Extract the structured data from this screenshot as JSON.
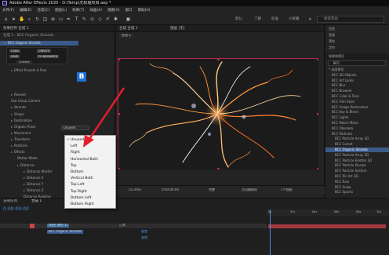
{
  "window": {
    "title": "Adobe After Effects 2020 - D:\\Temp\\无标题项目.aep *"
  },
  "menu": [
    "文件(F)",
    "编辑(E)",
    "合成(C)",
    "图层(L)",
    "效果(T)",
    "动画(A)",
    "视图(V)",
    "窗口",
    "帮助(H)"
  ],
  "toolbar": {
    "workspaces": [
      "默认",
      "了解",
      "标准",
      "小屏幕"
    ],
    "search_placeholder": "搜索帮助"
  },
  "effects_panel": {
    "tab_label": "效果控件 合成 1",
    "layer_label": "合成 1 · BCC Organic Strands",
    "effect_name": "BCC Organic Strands",
    "rows": [
      {
        "label": "BCC Organic Strands",
        "indent": 0,
        "caret": true
      },
      {
        "label": "Effect Presets & Pixe",
        "indent": 1,
        "caret": true
      },
      {
        "label": "Reseed",
        "indent": 1,
        "caret": true
      },
      {
        "label": "Use Comp Camera",
        "indent": 1,
        "caret": false
      },
      {
        "label": "Strands",
        "indent": 1,
        "caret": true
      },
      {
        "label": "Shape",
        "indent": 1,
        "caret": true
      },
      {
        "label": "Destination",
        "indent": 1,
        "caret": true
      },
      {
        "label": "Organic Pulse",
        "indent": 1,
        "caret": true
      },
      {
        "label": "Movement",
        "indent": 1,
        "caret": true
      },
      {
        "label": "Transform",
        "indent": 1,
        "caret": true
      },
      {
        "label": "Particles",
        "indent": 1,
        "caret": true
      },
      {
        "label": "Effects",
        "indent": 1,
        "caret": true
      },
      {
        "label": "Motion Mode",
        "indent": 2,
        "caret": false
      },
      {
        "label": "Distance",
        "indent": 2,
        "caret": true
      },
      {
        "label": "Distance Master",
        "indent": 3,
        "caret": true
      },
      {
        "label": "Distance X",
        "indent": 3,
        "caret": true
      },
      {
        "label": "Distance Y",
        "indent": 3,
        "caret": true
      },
      {
        "label": "Distance Z",
        "indent": 3,
        "caret": true
      },
      {
        "label": "Distance Relative",
        "indent": 3,
        "caret": false
      },
      {
        "label": "Distance Dim Curve",
        "indent": 3,
        "caret": false
      },
      {
        "label": "Fine Return Tension",
        "indent": 2,
        "caret": false
      }
    ],
    "motion_mode_value": "Unused",
    "preset_buttons": [
      "LOAD",
      "SAVE",
      "CREATE",
      "FX BROWSER"
    ],
    "current_label": "Current"
  },
  "dropdown": {
    "items": [
      "Unused",
      "Left",
      "Right",
      "Horizontal Both",
      "Top",
      "Bottom",
      "Vertical Both",
      "Top Left",
      "Top Right",
      "Bottom Left",
      "Bottom Right"
    ],
    "selected_index": 0
  },
  "composition": {
    "tab_label": "合成 合成 1",
    "layer_tab": "图层 (无)",
    "comp_name": "合成 1",
    "zoom": "(53.9%)",
    "timecode": "0:00:00:00",
    "quality": "完整",
    "camera": "活动摄像机",
    "views": "1个视图"
  },
  "right_panel": {
    "tabs": [
      "信息",
      "音频",
      "预览",
      "效果和预设",
      "字符"
    ],
    "effects_presets_label": "效果和预设",
    "search_placeholder": "BCC",
    "items": [
      {
        "label": "* 动画预设",
        "sel": false
      },
      {
        "label": "BCC 3D Objects",
        "sel": false
      },
      {
        "label": "BCC Art Looks",
        "sel": false
      },
      {
        "label": "BCC Blur",
        "sel": false
      },
      {
        "label": "BCC Browser",
        "sel": false
      },
      {
        "label": "BCC Color & Tone",
        "sel": false
      },
      {
        "label": "BCC Film Style",
        "sel": false
      },
      {
        "label": "BCC Image Restoration",
        "sel": false
      },
      {
        "label": "BCC Key & Blend",
        "sel": false
      },
      {
        "label": "BCC Lights",
        "sel": false
      },
      {
        "label": "BCC Match Move",
        "sel": false
      },
      {
        "label": "BCC Obsolete",
        "sel": false
      },
      {
        "label": "BCC Particles",
        "sel": false
      },
      {
        "label": "BCC Particle Array 3D",
        "sel": false
      },
      {
        "label": "BCC Comet",
        "sel": false
      },
      {
        "label": "BCC Organic Strands",
        "sel": true
      },
      {
        "label": "BCC Particle Array 3D",
        "sel": false
      },
      {
        "label": "BCC Particle Emitter 3D",
        "sel": false
      },
      {
        "label": "BCC Particle Illusion",
        "sel": false
      },
      {
        "label": "BCC Particle System",
        "sel": false
      },
      {
        "label": "BCC Pin Art 3D",
        "sel": false
      },
      {
        "label": "BCC Rain",
        "sel": false
      },
      {
        "label": "BCC Snow",
        "sel": false
      },
      {
        "label": "BCC Sparks",
        "sel": false
      }
    ]
  },
  "timeline": {
    "tab_label": "渲染队列",
    "comp_tab": "合成 1",
    "timecode": "0:00:00:00",
    "layer_name": "[纯色 纯色 1]",
    "effect_name": "BCC Organic Strands",
    "reset_label": "重置",
    "mode_label": "正常",
    "ruler": [
      "0s",
      "02s",
      "04s",
      "06s",
      "08s",
      "10s"
    ]
  },
  "colors": {
    "accent_blue": "#4d8fe0",
    "selection": "#3a5a8a",
    "comp_border": "#b32b4a",
    "arrow_red": "#e0202a"
  }
}
